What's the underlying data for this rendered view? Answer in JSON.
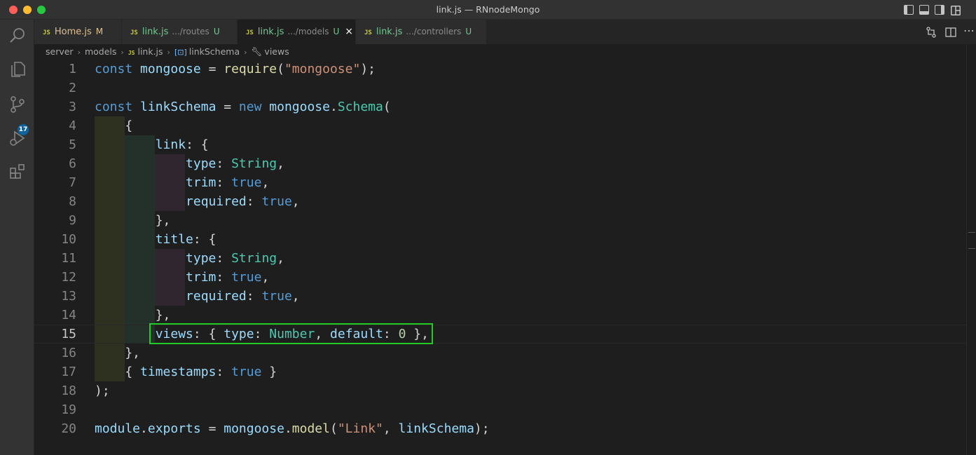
{
  "window": {
    "title": "link.js — RNnodeMongo"
  },
  "activity_bar": {
    "items": [
      "explorer-icon",
      "source-control-icon",
      "run-debug-icon",
      "extensions-icon",
      "search-icon"
    ],
    "scm_badge": "17"
  },
  "tabs": [
    {
      "icon": "JS",
      "name": "Home.js",
      "dir": "",
      "status": "M",
      "active": false
    },
    {
      "icon": "JS",
      "name": "link.js",
      "dir": ".../routes",
      "status": "U",
      "active": false
    },
    {
      "icon": "JS",
      "name": "link.js",
      "dir": ".../models",
      "status": "U",
      "active": true,
      "close": "×"
    },
    {
      "icon": "JS",
      "name": "link.js",
      "dir": ".../controllers",
      "status": "U",
      "active": false
    }
  ],
  "breadcrumb": {
    "segments": [
      "server",
      "models",
      "link.js",
      "linkSchema",
      "views"
    ]
  },
  "editor": {
    "current_line": 15,
    "lines": [
      {
        "n": "1",
        "text": "const mongoose = require(\"mongoose\");"
      },
      {
        "n": "2",
        "text": ""
      },
      {
        "n": "3",
        "text": "const linkSchema = new mongoose.Schema("
      },
      {
        "n": "4",
        "text": "{"
      },
      {
        "n": "5",
        "text": "link: {"
      },
      {
        "n": "6",
        "text": "type: String,"
      },
      {
        "n": "7",
        "text": "trim: true,"
      },
      {
        "n": "8",
        "text": "required: true,"
      },
      {
        "n": "9",
        "text": "},"
      },
      {
        "n": "10",
        "text": "title: {"
      },
      {
        "n": "11",
        "text": "type: String,"
      },
      {
        "n": "12",
        "text": "trim: true,"
      },
      {
        "n": "13",
        "text": "required: true,"
      },
      {
        "n": "14",
        "text": "},"
      },
      {
        "n": "15",
        "text": "views: { type: Number, default: 0 },"
      },
      {
        "n": "16",
        "text": "},"
      },
      {
        "n": "17",
        "text": "{ timestamps: true }"
      },
      {
        "n": "18",
        "text": ");"
      },
      {
        "n": "19",
        "text": ""
      },
      {
        "n": "20",
        "text": "module.exports = mongoose.model(\"Link\", linkSchema);"
      }
    ]
  },
  "colors": {
    "keyword": "#569cd6",
    "variable": "#9cdcfe",
    "function": "#dcdcaa",
    "string": "#ce9178",
    "class": "#4ec9b0",
    "number": "#b5cea8",
    "highlight_box": "#22cc22"
  }
}
